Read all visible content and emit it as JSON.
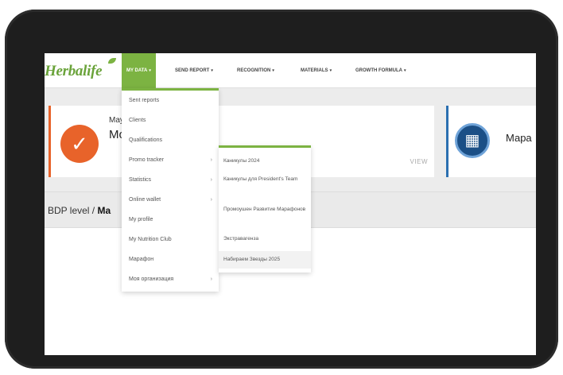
{
  "brand": {
    "logo_text": "Herbalife"
  },
  "nav": {
    "items": [
      {
        "label": "MY DATA"
      },
      {
        "label": "SEND REPORT"
      },
      {
        "label": "RECOGNITION"
      },
      {
        "label": "MATERIALS"
      },
      {
        "label": "GROWTH FORMULA"
      }
    ],
    "caret": "▾"
  },
  "dropdown": {
    "items": [
      {
        "label": "Sent reports"
      },
      {
        "label": "Clients"
      },
      {
        "label": "Qualifications"
      },
      {
        "label": "Promo tracker",
        "arrow": "›"
      },
      {
        "label": "Statistics",
        "arrow": "›"
      },
      {
        "label": "Online wallet",
        "arrow": "›"
      },
      {
        "label": "My profile"
      },
      {
        "label": "My Nutrition Club"
      },
      {
        "label": "Марафон"
      },
      {
        "label": "Моя организация",
        "arrow": "›"
      }
    ]
  },
  "submenu": {
    "items": [
      {
        "label": "Каникулы 2024"
      },
      {
        "label": "Каникулы для President's Team"
      },
      {
        "label": "Промоушен Развитие Марафонов"
      },
      {
        "label": "Экстравагенза"
      },
      {
        "label": "Набираем Звезды 2025"
      }
    ]
  },
  "card1": {
    "subtitle": "May",
    "title": "Mo",
    "link": "VIEW",
    "icon": "check-icon"
  },
  "card2": {
    "title": "Мара",
    "icon": "medal-icon"
  },
  "level": {
    "prefix": "BDP level / ",
    "value": "Ma"
  },
  "colors": {
    "accent": "#7cb342",
    "orange": "#e8632a",
    "blue": "#2a6fb0"
  }
}
